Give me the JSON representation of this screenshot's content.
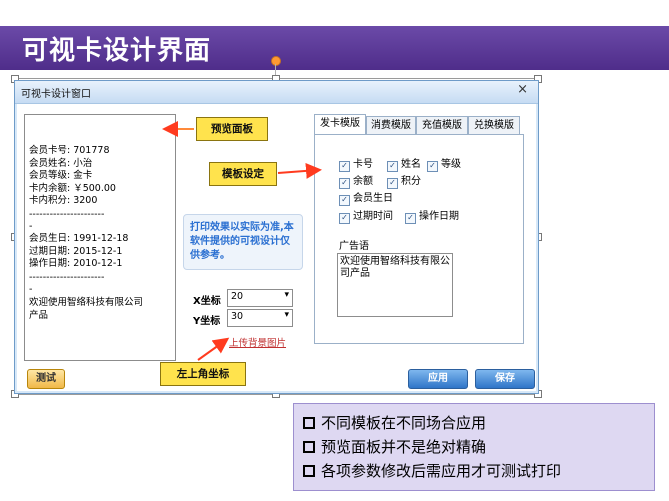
{
  "slide": {
    "title": "可视卡设计界面"
  },
  "window": {
    "title": "可视卡设计窗口",
    "close_glyph": "×"
  },
  "preview": {
    "lines": [
      "会员卡号: 701778",
      "会员姓名: 小治",
      "会员等级: 金卡",
      "卡内余额: ￥500.00",
      "卡内积分: 3200",
      "----------------------",
      "-",
      "会员生日: 1991-12-18",
      "过期日期: 2015-12-1",
      "操作日期: 2010-12-1",
      "----------------------",
      "-",
      "欢迎使用智络科技有限公司",
      "产品"
    ]
  },
  "note": {
    "text": "打印效果以实际为准,本软件提供的可视设计仅供参考。"
  },
  "coords": {
    "x_label": "X坐标",
    "x_value": "20",
    "y_label": "Y坐标",
    "y_value": "30",
    "chevron": "▾"
  },
  "upload_link": "上传背景图片",
  "tabs": [
    "发卡模版",
    "消费模版",
    "充值模版",
    "兑换模版"
  ],
  "checkboxes": {
    "card_no": "卡号",
    "name": "姓名",
    "level": "等级",
    "balance": "余额",
    "points": "积分",
    "birthday": "会员生日",
    "expire": "过期时间",
    "op_date": "操作日期",
    "check_glyph": "✓"
  },
  "ad": {
    "label": "广告语",
    "text": "欢迎使用智络科技有限公司产品"
  },
  "buttons": {
    "test": "测试",
    "apply": "应用",
    "save": "保存"
  },
  "callouts": {
    "preview_panel": "预览面板",
    "template_settings": "模板设定",
    "top_left_coord": "左上角坐标"
  },
  "info": {
    "items": [
      "不同模板在不同场合应用",
      "预览面板并不是绝对精确",
      "各项参数修改后需应用才可测试打印"
    ]
  },
  "colors": {
    "slide_bar": "#5a3a98",
    "callout": "#ffe34d",
    "arrow": "#ff3b1f",
    "info_box": "#ded8f2"
  }
}
